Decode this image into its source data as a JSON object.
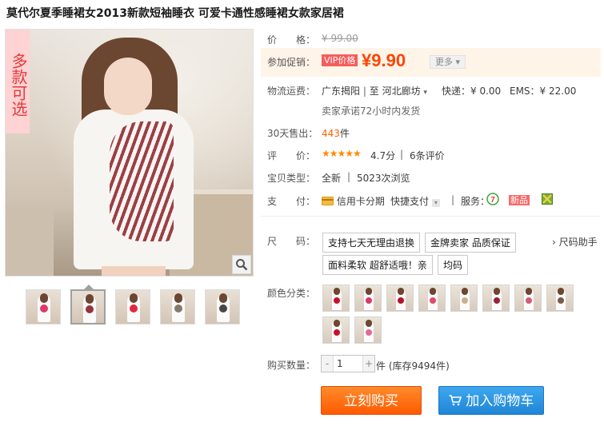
{
  "title": "莫代尔夏季睡裙女2013新款短袖睡衣 可爱卡通性感睡裙女款家居裙",
  "badge": "多款可选",
  "price": {
    "label": "价　　格：",
    "original": "¥ 99.00"
  },
  "promo": {
    "label": "参加促销：",
    "vip_tag": "VIP价格",
    "currency": "¥",
    "amount": "9.90",
    "more": "更多"
  },
  "shipping": {
    "label": "物流运费：",
    "from": "广东揭阳",
    "sep": "至",
    "to": "河北廊坊",
    "express": "快递：¥ 0.00",
    "ems": "EMS：¥ 22.00",
    "promise": "卖家承诺72小时内发货"
  },
  "sales": {
    "label": "30天售出：",
    "count": "443",
    "unit": "件"
  },
  "rating": {
    "label": "评　　价：",
    "stars": "★★★★★",
    "score": "4.7分",
    "reviews": "6条评价"
  },
  "type": {
    "label": "宝贝类型：",
    "value": "全新",
    "views": "5023次浏览"
  },
  "payment": {
    "label": "支　　付：",
    "installment": "信用卡分期",
    "quickpay": "快捷支付",
    "service_label": "服务：",
    "new_tag": "新品"
  },
  "size": {
    "label": "尺　　码：",
    "options": [
      "支持七天无理由退换",
      "金牌卖家 品质保证",
      "面料柔软 超舒适哦！亲",
      "均码"
    ],
    "helper": "尺码助手"
  },
  "color": {
    "label": "颜色分类：",
    "swatch_colors": [
      "#c8102e",
      "#d33b6b",
      "#b4122a",
      "#e14a6e",
      "#c7b08a",
      "#9a1f3a",
      "#d25a7a",
      "#7a5a4a",
      "#c8102e",
      "#e26b9a"
    ]
  },
  "quantity": {
    "label": "购买数量：",
    "minus": "-",
    "value": "1",
    "plus": "+",
    "unit": "件",
    "stock": "(库存9494件)"
  },
  "actions": {
    "buy": "立刻购买",
    "cart": "加入购物车"
  }
}
